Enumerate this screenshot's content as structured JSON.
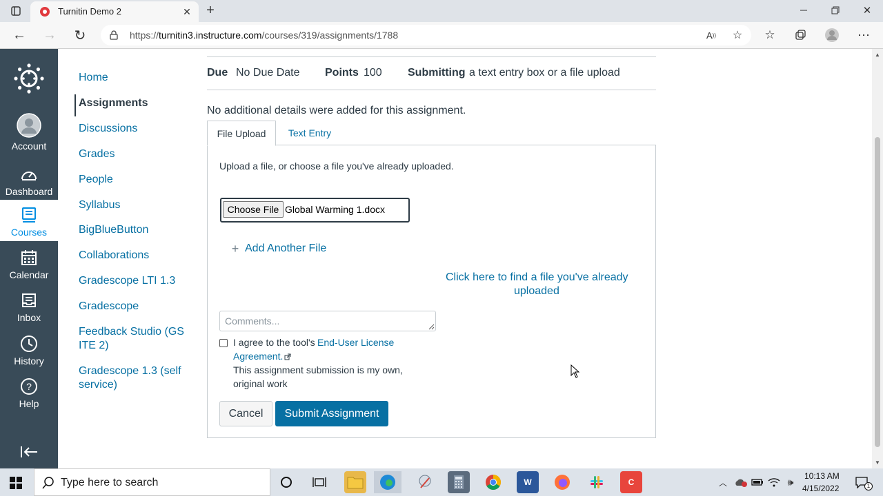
{
  "browser": {
    "tab_title": "Turnitin Demo 2",
    "url_prefix": "https://",
    "url_host": "turnitin3.instructure.com",
    "url_path": "/courses/319/assignments/1788"
  },
  "global_nav": {
    "items": [
      {
        "label": "Account",
        "icon": "user-avatar-icon"
      },
      {
        "label": "Dashboard",
        "icon": "dashboard-icon"
      },
      {
        "label": "Courses",
        "icon": "book-icon"
      },
      {
        "label": "Calendar",
        "icon": "calendar-icon"
      },
      {
        "label": "Inbox",
        "icon": "inbox-icon"
      },
      {
        "label": "History",
        "icon": "clock-icon"
      },
      {
        "label": "Help",
        "icon": "help-icon"
      }
    ]
  },
  "course_nav": {
    "items": [
      "Home",
      "Assignments",
      "Discussions",
      "Grades",
      "People",
      "Syllabus",
      "BigBlueButton",
      "Collaborations",
      "Gradescope LTI 1.3",
      "Gradescope",
      "Feedback Studio (GS",
      "ITE 2)",
      "Gradescope 1.3 (self",
      "service)"
    ]
  },
  "assignment": {
    "due_label": "Due",
    "due_value": "No Due Date",
    "points_label": "Points",
    "points_value": "100",
    "submitting_label": "Submitting",
    "submitting_value": "a text entry box or a file upload",
    "details": "No additional details were added for this assignment."
  },
  "submission": {
    "tab_file": "File Upload",
    "tab_text": "Text Entry",
    "instructions": "Upload a file, or choose a file you've already uploaded.",
    "choose_file": "Choose File",
    "file_name": "Global Warming 1.docx",
    "add_another": "Add Another File",
    "find_file_line1": "Click here to find a file you've already",
    "find_file_line2": "uploaded",
    "comments_placeholder": "Comments...",
    "agree_prefix": "I agree to the tool's ",
    "eula_link_1": "End-User License",
    "eula_link_2": "Agreement.",
    "own_work_1": "This assignment submission is my own,",
    "own_work_2": "original work",
    "cancel": "Cancel",
    "submit": "Submit Assignment"
  },
  "taskbar": {
    "search_placeholder": "Type here to search",
    "time": "10:13 AM",
    "date": "4/15/2022"
  },
  "colors": {
    "canvas_nav": "#394b58",
    "link": "#0770a3",
    "button_primary": "#0770a3"
  }
}
